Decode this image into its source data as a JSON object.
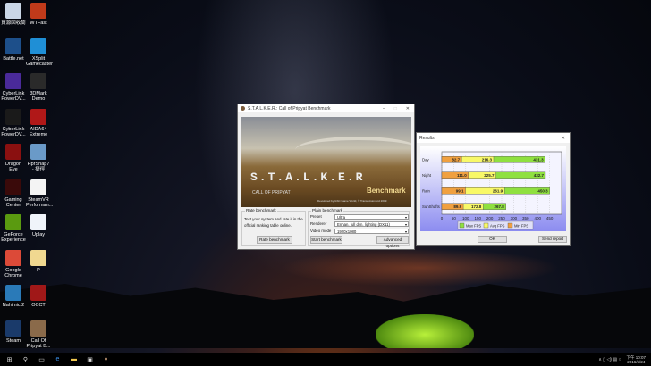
{
  "desktop_icons": [
    {
      "label": "資源回收筒",
      "color": "#c9d6e6"
    },
    {
      "label": "WTFast",
      "color": "#c03a1a"
    },
    {
      "label": "Battle.net",
      "color": "#1d4f8a"
    },
    {
      "label": "XSplit Gamecaster",
      "color": "#1f8fd6"
    },
    {
      "label": "CyberLink PowerDV...",
      "color": "#4a2a9a"
    },
    {
      "label": "3DMark Demo",
      "color": "#2a2a2a"
    },
    {
      "label": "CyberLink PowerDV...",
      "color": "#1a1a1a"
    },
    {
      "label": "AIDA64 Extreme",
      "color": "#b01818"
    },
    {
      "label": "Dragon Eye",
      "color": "#8a1010"
    },
    {
      "label": "HprSnap7 - 捷徑",
      "color": "#6a9ac8"
    },
    {
      "label": "Gaming Center",
      "color": "#3a0a0a"
    },
    {
      "label": "SteamVR Performan...",
      "color": "#f4f4f4"
    },
    {
      "label": "GeForce Experience",
      "color": "#5a9a10"
    },
    {
      "label": "Uplay",
      "color": "#f0f4fa"
    },
    {
      "label": "Google Chrome",
      "color": "#dc4a38"
    },
    {
      "label": "P",
      "color": "#f0d890"
    },
    {
      "label": "Nahimic 2",
      "color": "#2a7ab8"
    },
    {
      "label": "OCCT",
      "color": "#a01818"
    },
    {
      "label": "Steam",
      "color": "#1a3a6a"
    },
    {
      "label": "Call Of Pripyat B...",
      "color": "#8a6a4a"
    }
  ],
  "bench": {
    "title": "S.T.A.L.K.E.R.: Call of Pripyat Benchmark",
    "logo": "S.T.A.L.K.E.R. CALL OF PRIPYAT",
    "banner_text": "Benchmark",
    "credits": "Developed by GSC Game World, © Transavision Ltd 2009",
    "rate_group": "Rate benchmark",
    "rate_desc": "Test your system and rate it in the official ranking table online.",
    "rate_button": "Rate benchmark",
    "plain_group": "Plain benchmark",
    "preset_label": "Preset",
    "preset_value": "Ultra",
    "renderer_label": "Renderer",
    "renderer_value": "Enhan. full dyn. lighting (DX11)",
    "video_label": "Video mode",
    "video_value": "1920x1080",
    "start_button": "Start benchmark",
    "advanced_button": "Advanced options"
  },
  "results": {
    "title": "Results",
    "ok": "OK",
    "send_report": "Send report"
  },
  "chart_data": {
    "type": "bar",
    "orientation": "horizontal",
    "categories": [
      "Day",
      "Night",
      "Rain",
      "SunShafts"
    ],
    "series": [
      {
        "name": "Max FPS",
        "color": "#8fe040",
        "values": [
          431.3,
          432.7,
          450.3,
          267.8
        ]
      },
      {
        "name": "Avg FPS",
        "color": "#f8f868",
        "values": [
          216.3,
          225.7,
          261.9,
          172.8
        ]
      },
      {
        "name": "Min FPS",
        "color": "#f0a040",
        "values": [
          82.7,
          111.0,
          99.1,
          89.9
        ]
      }
    ],
    "xticks": [
      "0",
      "50",
      "100",
      "150",
      "200",
      "250",
      "300",
      "350",
      "400",
      "450"
    ],
    "xlim": [
      0,
      500
    ],
    "legend": "bottom"
  },
  "taskbar": {
    "time": "下午 10:07",
    "date": "2016/6/24"
  }
}
